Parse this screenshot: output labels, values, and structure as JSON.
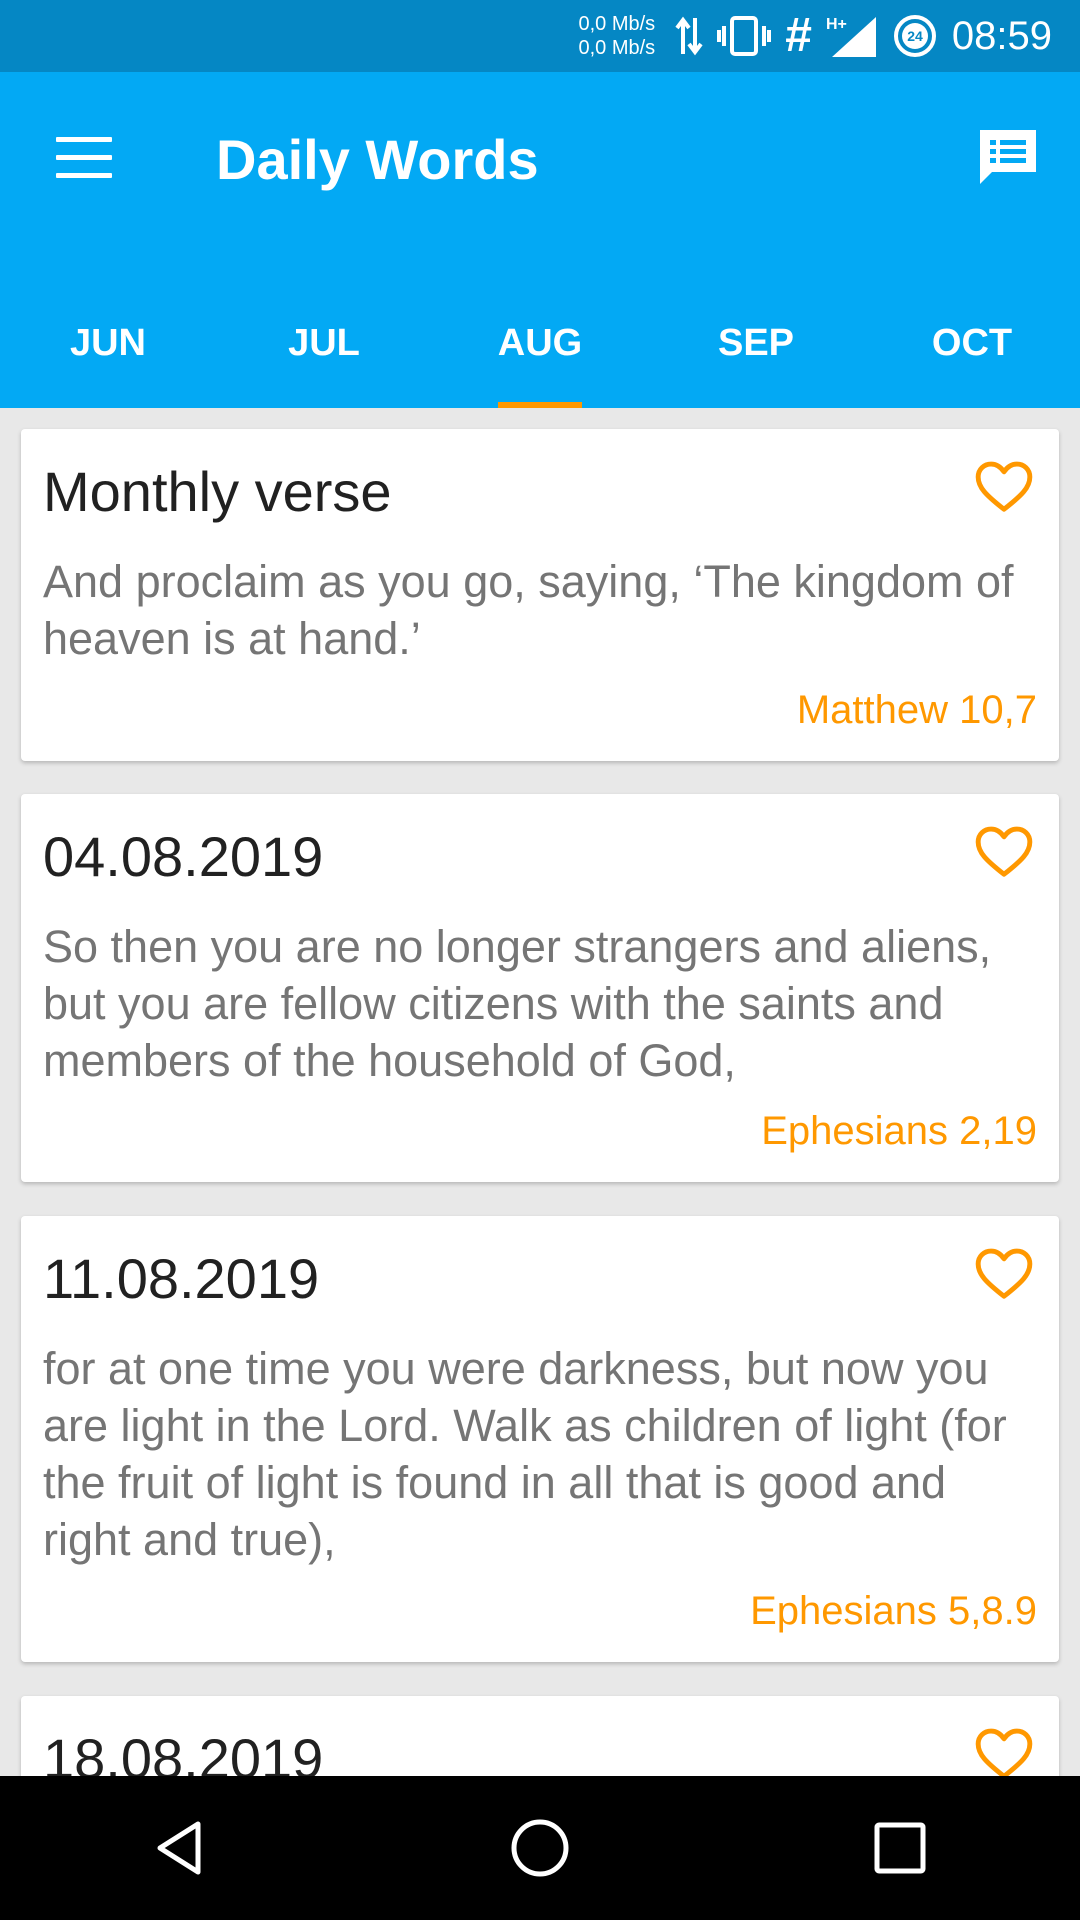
{
  "status_bar": {
    "net_up": "0,0 Mb/s",
    "net_down": "0,0 Mb/s",
    "network_type": "H+",
    "data_saver_badge": "24",
    "time": "08:59",
    "icons": [
      "data-transfer-icon",
      "vibrate-icon",
      "hash-icon",
      "signal-icon",
      "data-saver-icon"
    ]
  },
  "app_bar": {
    "title": "Daily Words",
    "menu_icon": "hamburger-menu-icon",
    "action_icon": "chat-list-icon",
    "color": "#03a9f4"
  },
  "tabs": [
    {
      "label": "JUN",
      "active": false
    },
    {
      "label": "JUL",
      "active": false
    },
    {
      "label": "AUG",
      "active": true
    },
    {
      "label": "SEP",
      "active": false
    },
    {
      "label": "OCT",
      "active": false
    }
  ],
  "accent_color": "#ff9800",
  "cards": [
    {
      "title": "Monthly verse",
      "text": "And proclaim as you go, saying, ‘The kingdom of heaven is at hand.’",
      "reference": "Matthew 10,7"
    },
    {
      "title": "04.08.2019",
      "text": "So then you are no longer strangers and aliens, but you are fellow citizens with the saints and members of the household of God,",
      "reference": "Ephesians 2,19"
    },
    {
      "title": "11.08.2019",
      "text": "for at one time you were darkness, but now you are light in the Lord. Walk as children of light (for the fruit of light is found in all that is good and right and true),",
      "reference": "Ephesians 5,8.9"
    },
    {
      "title": "18.08.2019"
    }
  ],
  "nav_bar": {
    "icons": [
      "back-icon",
      "home-icon",
      "recents-icon"
    ]
  }
}
